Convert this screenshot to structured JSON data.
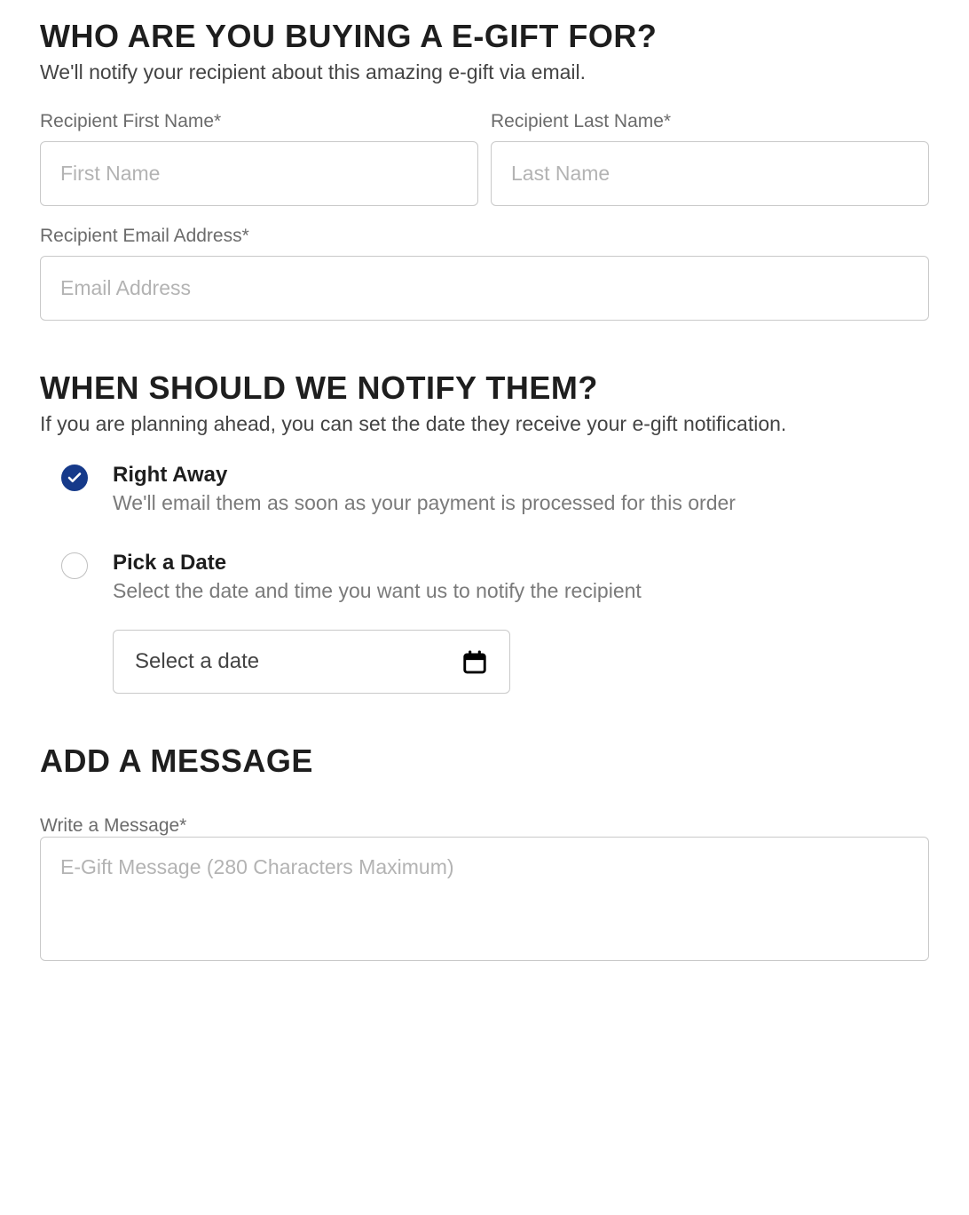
{
  "recipient": {
    "heading": "WHO ARE YOU BUYING A E-GIFT FOR?",
    "subtitle": "We'll notify your recipient about this amazing e-gift via email.",
    "first_name_label": "Recipient First Name*",
    "first_name_placeholder": "First Name",
    "first_name_value": "",
    "last_name_label": "Recipient Last Name*",
    "last_name_placeholder": "Last Name",
    "last_name_value": "",
    "email_label": "Recipient Email Address*",
    "email_placeholder": "Email Address",
    "email_value": ""
  },
  "notify": {
    "heading": "WHEN SHOULD WE NOTIFY THEM?",
    "subtitle": "If you are planning ahead, you can set the date they receive your e-gift notification.",
    "options": [
      {
        "title": "Right Away",
        "desc": "We'll email them as soon as your payment is processed for this order",
        "selected": true
      },
      {
        "title": "Pick a Date",
        "desc": "Select the date and time you want us to notify the recipient",
        "selected": false
      }
    ],
    "date_picker_text": "Select a date"
  },
  "message": {
    "heading": "ADD A MESSAGE",
    "label": "Write a Message*",
    "placeholder": "E-Gift Message (280 Characters Maximum)",
    "value": ""
  },
  "colors": {
    "radio_selected": "#163a8a"
  }
}
